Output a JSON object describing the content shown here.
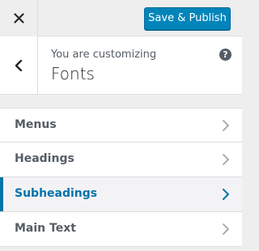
{
  "header": {
    "close_icon": "close-icon",
    "publish_label": "Save & Publish",
    "publish_color": "#0085ba"
  },
  "section": {
    "back_icon": "chevron-left-icon",
    "customizing_label": "You are customizing",
    "title": "Fonts",
    "help_icon": "help-icon",
    "help_glyph": "?"
  },
  "menu": {
    "items": [
      {
        "label": "Menus",
        "active": false
      },
      {
        "label": "Headings",
        "active": false
      },
      {
        "label": "Subheadings",
        "active": true
      },
      {
        "label": "Main Text",
        "active": false
      }
    ],
    "active_color": "#0073aa",
    "chevron_icon": "chevron-right-icon"
  }
}
